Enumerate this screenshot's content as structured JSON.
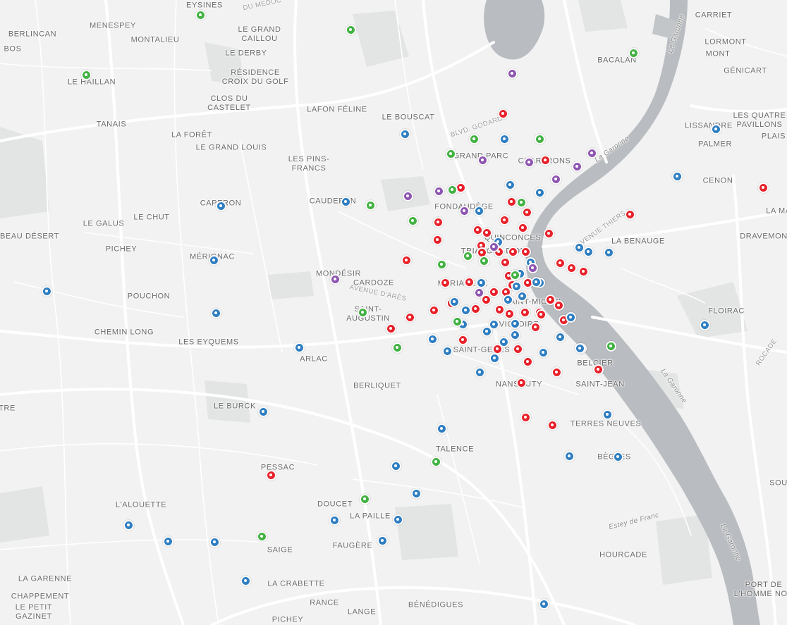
{
  "colors": {
    "background": "#f2f2f2",
    "water": "#b9bcc0",
    "road": "#ffffff",
    "park": "#e2e4e4",
    "marker_red": "#e8222b",
    "marker_blue": "#2f7ec1",
    "marker_green": "#43b244",
    "marker_purple": "#8e56b1"
  },
  "place_labels": [
    {
      "text": "EYSINES",
      "kind": "place"
    },
    {
      "text": "DU MEDOC",
      "kind": "road"
    },
    {
      "text": "BERLINCAN",
      "kind": "place"
    },
    {
      "text": "BOS",
      "kind": "place"
    },
    {
      "text": "MENESPEY",
      "kind": "place"
    },
    {
      "text": "MONTALIEU",
      "kind": "place"
    },
    {
      "text": "LE GRAND\nCAILLOU",
      "kind": "place"
    },
    {
      "text": "LE DERBY",
      "kind": "place"
    },
    {
      "text": "LE HAILLAN",
      "kind": "place"
    },
    {
      "text": "RÉSIDENCE\nCROIX DU GOLF",
      "kind": "place"
    },
    {
      "text": "CLOS DU\nCASTELET",
      "kind": "place"
    },
    {
      "text": "TANAIS",
      "kind": "place"
    },
    {
      "text": "LAFON FÉLINE",
      "kind": "place"
    },
    {
      "text": "LE BOUSCAT",
      "kind": "place"
    },
    {
      "text": "LA FORÊT",
      "kind": "place"
    },
    {
      "text": "LE GRAND LOUIS",
      "kind": "place"
    },
    {
      "text": "LES PINS-\nFRANCS",
      "kind": "place"
    },
    {
      "text": "CAPERON",
      "kind": "place"
    },
    {
      "text": "CAUDERAN",
      "kind": "place"
    },
    {
      "text": "LE CHUT",
      "kind": "place"
    },
    {
      "text": "LE GALUS",
      "kind": "place"
    },
    {
      "text": "BEAU DÉSERT",
      "kind": "place"
    },
    {
      "text": "PICHEY",
      "kind": "place"
    },
    {
      "text": "MÉRIGNAC",
      "kind": "place"
    },
    {
      "text": "MONDÉSIR",
      "kind": "place"
    },
    {
      "text": "AVENUE D'ARÈS",
      "kind": "road"
    },
    {
      "text": "CARDOZE",
      "kind": "place"
    },
    {
      "text": "POUCHON",
      "kind": "place"
    },
    {
      "text": "SAINT-\nAUGUSTIN",
      "kind": "place"
    },
    {
      "text": "CHEMIN LONG",
      "kind": "place"
    },
    {
      "text": "LES EYQUEMS",
      "kind": "place"
    },
    {
      "text": "ARLAC",
      "kind": "place"
    },
    {
      "text": "BERLIQUET",
      "kind": "place"
    },
    {
      "text": "LE BURCK",
      "kind": "place"
    },
    {
      "text": "TRE",
      "kind": "place"
    },
    {
      "text": "PESSAC",
      "kind": "place"
    },
    {
      "text": "TALENCE",
      "kind": "place"
    },
    {
      "text": "L'ALOUETTE",
      "kind": "place"
    },
    {
      "text": "DOUCET",
      "kind": "place"
    },
    {
      "text": "LA PAILLE",
      "kind": "place"
    },
    {
      "text": "SAIGE",
      "kind": "place"
    },
    {
      "text": "FAUGÈRE",
      "kind": "place"
    },
    {
      "text": "LA GARENNE",
      "kind": "place"
    },
    {
      "text": "CHAPPEMENT",
      "kind": "place"
    },
    {
      "text": "LE PETIT\nGAZINET",
      "kind": "place"
    },
    {
      "text": "LA CRABETTE",
      "kind": "place"
    },
    {
      "text": "RANCE",
      "kind": "place"
    },
    {
      "text": "LANGE",
      "kind": "place"
    },
    {
      "text": "BÉNÉDIGUES",
      "kind": "place"
    },
    {
      "text": "PICHEY",
      "kind": "place"
    },
    {
      "text": "BLVD. GODARD",
      "kind": "road"
    },
    {
      "text": "GRAND PARC",
      "kind": "place"
    },
    {
      "text": "CHARTRONS",
      "kind": "place"
    },
    {
      "text": "FONDAUDÈGE",
      "kind": "place"
    },
    {
      "text": "QUINCONCES",
      "kind": "place"
    },
    {
      "text": "TRIANGLE D'OR",
      "kind": "place"
    },
    {
      "text": "MÉRIADECK",
      "kind": "place"
    },
    {
      "text": "SAINT-MICHEL",
      "kind": "place"
    },
    {
      "text": "VICTOIRE",
      "kind": "place"
    },
    {
      "text": "SAINT-GENÈS",
      "kind": "place"
    },
    {
      "text": "NANSOUTY",
      "kind": "place"
    },
    {
      "text": "BELCIER",
      "kind": "place"
    },
    {
      "text": "SAINT-JEAN",
      "kind": "place"
    },
    {
      "text": "TERRES NEUVES",
      "kind": "place"
    },
    {
      "text": "BÈGLES",
      "kind": "place"
    },
    {
      "text": "HOURCADE",
      "kind": "place"
    },
    {
      "text": "Estey de Franc",
      "kind": "water"
    },
    {
      "text": "BACALAN",
      "kind": "place"
    },
    {
      "text": "CARRIET",
      "kind": "place"
    },
    {
      "text": "LORMONT",
      "kind": "place"
    },
    {
      "text": "MONT",
      "kind": "place"
    },
    {
      "text": "GÉNICART",
      "kind": "place"
    },
    {
      "text": "LISSANDRE",
      "kind": "place"
    },
    {
      "text": "LES QUATRE\nPAVILLONS",
      "kind": "place"
    },
    {
      "text": "PLAIS",
      "kind": "place"
    },
    {
      "text": "PALMER",
      "kind": "place"
    },
    {
      "text": "CENON",
      "kind": "place"
    },
    {
      "text": "LA MA",
      "kind": "place"
    },
    {
      "text": "DRAVEMON",
      "kind": "place"
    },
    {
      "text": "LA BENAUGE",
      "kind": "place"
    },
    {
      "text": "AVENUE THIERS",
      "kind": "road"
    },
    {
      "text": "FLOIRAC",
      "kind": "place"
    },
    {
      "text": "ROCADE",
      "kind": "road"
    },
    {
      "text": "La Garonne",
      "kind": "water"
    },
    {
      "text": "La Garonne",
      "kind": "water"
    },
    {
      "text": "La Garonne",
      "kind": "water"
    },
    {
      "text": "La Garonne",
      "kind": "water"
    },
    {
      "text": "SOU",
      "kind": "place"
    },
    {
      "text": "PORT DE\nL'HOMME NOR",
      "kind": "place"
    }
  ],
  "markers": {
    "red": 58,
    "blue": 57,
    "green": 22,
    "purple": 13
  }
}
